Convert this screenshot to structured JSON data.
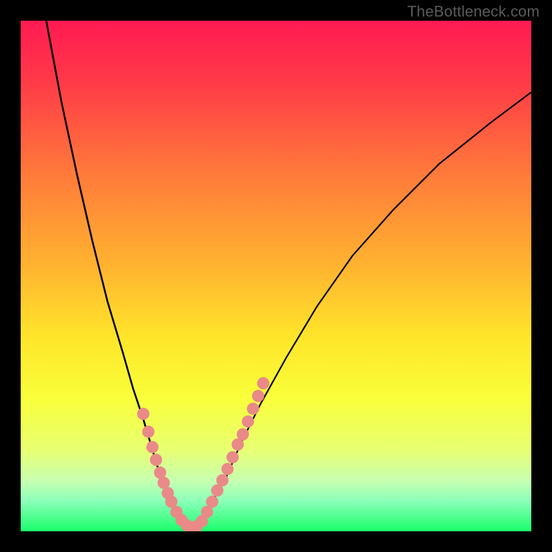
{
  "watermark": "TheBottleneck.com",
  "chart_data": {
    "type": "line",
    "title": "",
    "xlabel": "",
    "ylabel": "",
    "xlim": [
      0,
      100
    ],
    "ylim": [
      0,
      100
    ],
    "gradient_stops": [
      {
        "offset": 0.0,
        "color": "#ff1a52"
      },
      {
        "offset": 0.12,
        "color": "#ff3a48"
      },
      {
        "offset": 0.3,
        "color": "#ff7a3a"
      },
      {
        "offset": 0.48,
        "color": "#ffb330"
      },
      {
        "offset": 0.62,
        "color": "#ffe52a"
      },
      {
        "offset": 0.74,
        "color": "#f9ff3a"
      },
      {
        "offset": 0.84,
        "color": "#e8ff72"
      },
      {
        "offset": 0.9,
        "color": "#c8ffb0"
      },
      {
        "offset": 0.94,
        "color": "#8dffba"
      },
      {
        "offset": 1.0,
        "color": "#1aff6a"
      }
    ],
    "series": [
      {
        "name": "left-branch",
        "x": [
          5,
          8,
          11,
          14,
          17,
          20,
          22,
          24,
          25.5,
          27,
          28.5,
          30,
          31,
          32,
          33
        ],
        "y": [
          100,
          84,
          70,
          57,
          45,
          35,
          28,
          22,
          17,
          12,
          8,
          5,
          3,
          1.5,
          0.5
        ]
      },
      {
        "name": "right-branch",
        "x": [
          33,
          35,
          37,
          40,
          43,
          47,
          52,
          58,
          65,
          73,
          82,
          92,
          100
        ],
        "y": [
          0.5,
          2,
          5,
          10,
          17,
          25,
          34,
          44,
          54,
          63,
          72,
          80,
          86
        ]
      }
    ],
    "dots": {
      "name": "highlight-dots",
      "color": "#e98a88",
      "radius": 1.2,
      "points": [
        {
          "x": 24.0,
          "y": 23.0
        },
        {
          "x": 25.0,
          "y": 19.5
        },
        {
          "x": 25.8,
          "y": 16.5
        },
        {
          "x": 26.5,
          "y": 14.0
        },
        {
          "x": 27.3,
          "y": 11.5
        },
        {
          "x": 28.0,
          "y": 9.5
        },
        {
          "x": 28.8,
          "y": 7.5
        },
        {
          "x": 29.5,
          "y": 5.8
        },
        {
          "x": 30.5,
          "y": 3.8
        },
        {
          "x": 31.5,
          "y": 2.2
        },
        {
          "x": 32.5,
          "y": 1.2
        },
        {
          "x": 33.5,
          "y": 0.8
        },
        {
          "x": 34.5,
          "y": 1.0
        },
        {
          "x": 35.5,
          "y": 2.0
        },
        {
          "x": 36.5,
          "y": 3.8
        },
        {
          "x": 37.5,
          "y": 5.8
        },
        {
          "x": 38.5,
          "y": 8.0
        },
        {
          "x": 39.5,
          "y": 10.0
        },
        {
          "x": 40.5,
          "y": 12.2
        },
        {
          "x": 41.5,
          "y": 14.5
        },
        {
          "x": 42.5,
          "y": 17.0
        },
        {
          "x": 43.5,
          "y": 19.0
        },
        {
          "x": 44.5,
          "y": 21.5
        },
        {
          "x": 45.5,
          "y": 24.0
        },
        {
          "x": 46.5,
          "y": 26.5
        },
        {
          "x": 47.5,
          "y": 29.0
        }
      ]
    }
  }
}
